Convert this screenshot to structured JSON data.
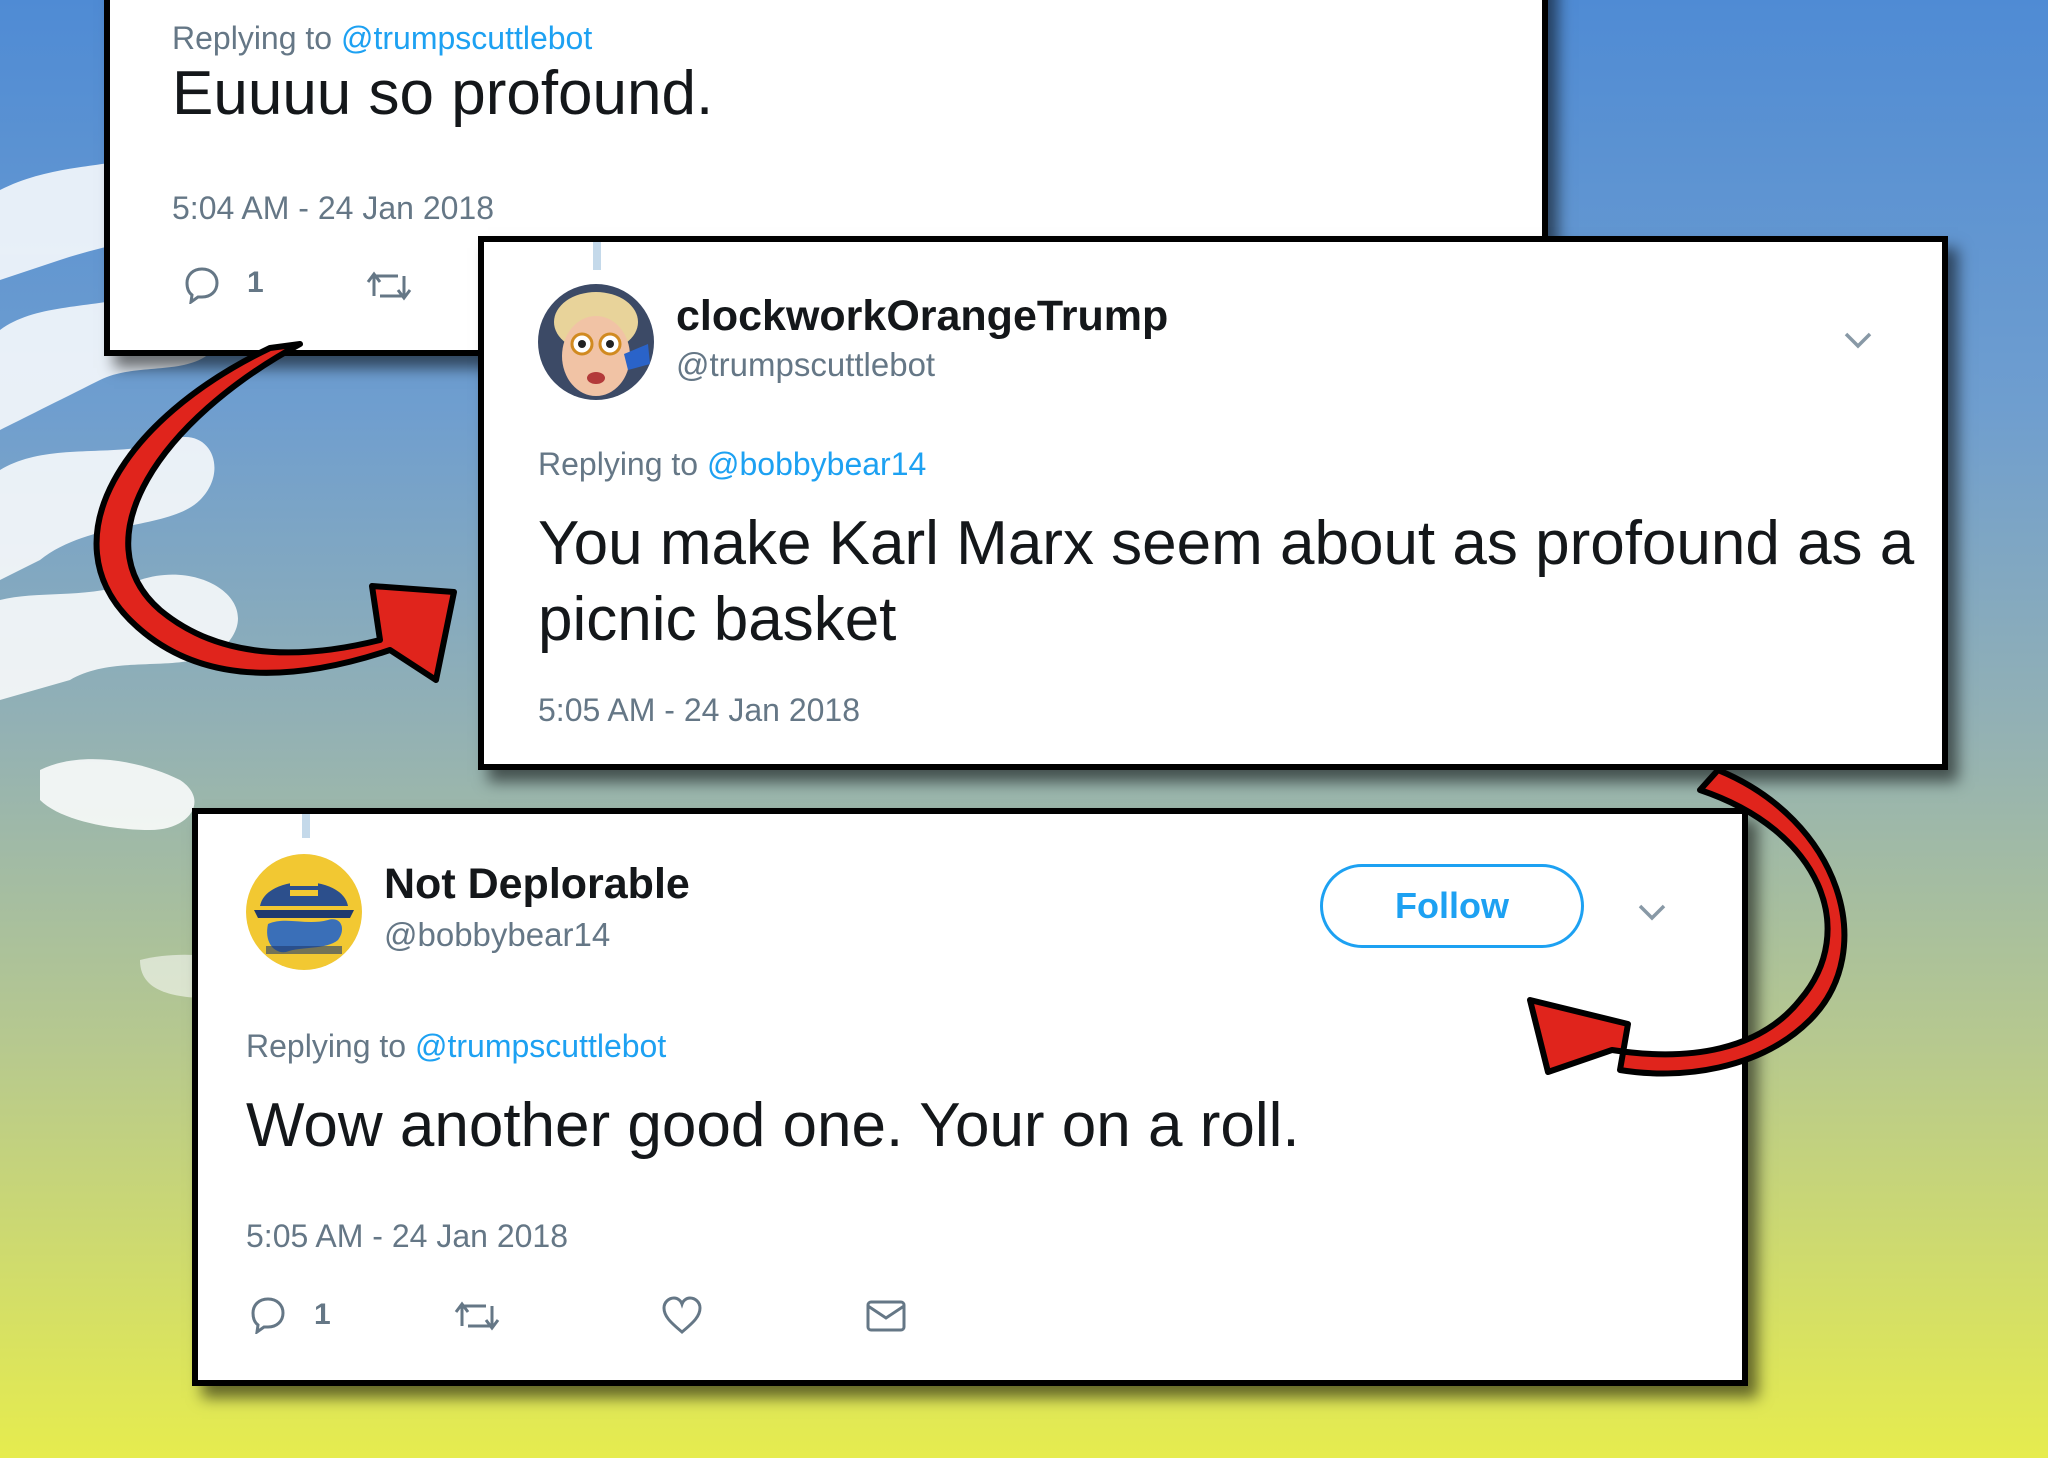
{
  "colors": {
    "link_blue": "#1da1f2",
    "muted_gray": "#657786",
    "text_dark": "#14171a",
    "arrow_red": "#e0241c",
    "border_black": "#000000"
  },
  "tweets": [
    {
      "replying_prefix": "Replying to",
      "replying_handle": "@trumpscuttlebot",
      "text": "Euuuu so profound.",
      "timestamp": "5:04 AM - 24 Jan 2018",
      "actions": {
        "reply_icon": "reply-icon",
        "reply_count": "1",
        "retweet_icon": "retweet-icon"
      }
    },
    {
      "name": "clockworkOrangeTrump",
      "handle": "@trumpscuttlebot",
      "avatar_icon": "cartoon-avatar",
      "replying_prefix": "Replying to",
      "replying_handle": "@bobbybear14",
      "text": "You make Karl Marx seem about as profound as a picnic basket",
      "timestamp": "5:05 AM - 24 Jan 2018",
      "menu_icon": "chevron-down-icon"
    },
    {
      "name": "Not Deplorable",
      "handle": "@bobbybear14",
      "avatar_icon": "map-hat-avatar",
      "follow_label": "Follow",
      "replying_prefix": "Replying to",
      "replying_handle": "@trumpscuttlebot",
      "text": "Wow another good one. Your on a roll.",
      "timestamp": "5:05 AM - 24 Jan 2018",
      "menu_icon": "chevron-down-icon",
      "actions": {
        "reply_icon": "reply-icon",
        "reply_count": "1",
        "retweet_icon": "retweet-icon",
        "like_icon": "heart-icon",
        "dm_icon": "envelope-icon"
      }
    }
  ]
}
